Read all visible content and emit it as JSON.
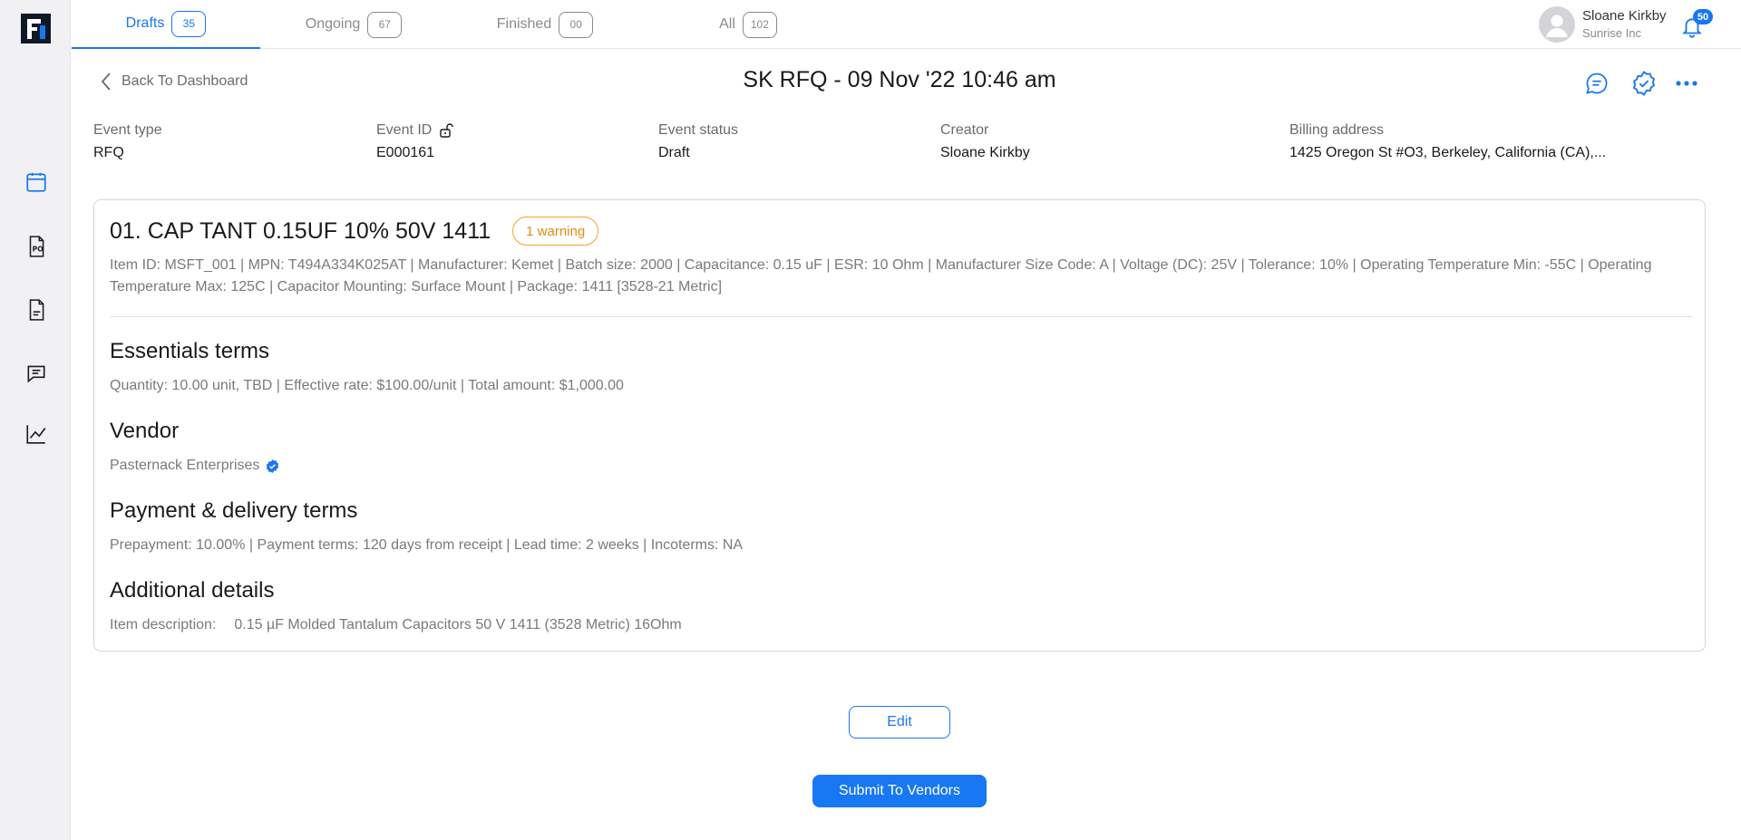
{
  "tabs": [
    {
      "label": "Drafts",
      "count": "35"
    },
    {
      "label": "Ongoing",
      "count": "67"
    },
    {
      "label": "Finished",
      "count": "00"
    },
    {
      "label": "All",
      "count": "102"
    }
  ],
  "user": {
    "name": "Sloane Kirkby",
    "org": "Sunrise Inc"
  },
  "notifications": {
    "count": "50"
  },
  "header": {
    "back_label": "Back To Dashboard",
    "title": "SK RFQ - 09 Nov '22 10:46 am"
  },
  "meta": {
    "event_type": {
      "label": "Event type",
      "value": "RFQ"
    },
    "event_id": {
      "label": "Event ID",
      "value": "E000161"
    },
    "event_status": {
      "label": "Event status",
      "value": "Draft"
    },
    "creator": {
      "label": "Creator",
      "value": "Sloane Kirkby"
    },
    "billing_address": {
      "label": "Billing address",
      "value": "1425 Oregon St #O3, Berkeley, California (CA),..."
    }
  },
  "item": {
    "title": "01. CAP TANT 0.15UF 10% 50V 1411",
    "warning": "1 warning",
    "details": "Item ID: MSFT_001  | MPN: T494A334K025AT | Manufacturer: Kemet | Batch size: 2000 | Capacitance: 0.15 uF | ESR: 10 Ohm | Manufacturer Size Code: A | Voltage (DC): 25V | Tolerance: 10% | Operating Temperature Min: -55C | Operating Temperature Max: 125C | Capacitor Mounting: Surface Mount | Package: 1411 [3528-21 Metric]"
  },
  "sections": {
    "essentials": {
      "title": "Essentials terms",
      "body": "Quantity: 10.00 unit, TBD | Effective rate: $100.00/unit | Total amount: $1,000.00"
    },
    "vendor": {
      "title": "Vendor",
      "body": "Pasternack Enterprises"
    },
    "payment": {
      "title": "Payment & delivery terms",
      "body": "Prepayment: 10.00% | Payment terms: 120 days from receipt | Lead time: 2 weeks | Incoterms: NA"
    },
    "additional": {
      "title": "Additional details",
      "desc_label": "Item description:",
      "desc_value": "0.15 µF Molded Tantalum Capacitors 50 V 1411 (3528 Metric) 16Ohm"
    }
  },
  "buttons": {
    "edit": "Edit",
    "submit": "Submit To Vendors"
  },
  "icons": {
    "rail": [
      "calendar-icon",
      "purchase-order-icon",
      "invoice-icon",
      "chat-icon",
      "analytics-icon"
    ],
    "header": [
      "comment-icon",
      "verified-check-icon",
      "more-options-icon"
    ]
  },
  "colors": {
    "accent": "#1877f2",
    "warning": "#f0a22b",
    "muted_text": "#7a7a7a"
  }
}
